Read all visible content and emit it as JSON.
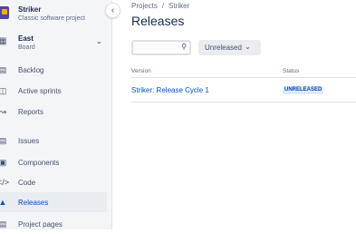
{
  "project": {
    "name": "Striker",
    "type": "Classic software project",
    "icon": "project-avatar-icon"
  },
  "board": {
    "name": "East",
    "sub": "Board",
    "icon": "board-icon"
  },
  "sidebar": {
    "items": [
      {
        "label": "Backlog",
        "icon": "backlog-icon"
      },
      {
        "label": "Active sprints",
        "icon": "active-sprints-icon"
      },
      {
        "label": "Reports",
        "icon": "reports-icon"
      },
      {
        "label": "Issues",
        "icon": "issues-icon"
      },
      {
        "label": "Components",
        "icon": "components-icon"
      },
      {
        "label": "Code",
        "icon": "code-icon"
      },
      {
        "label": "Releases",
        "icon": "releases-icon",
        "active": true
      },
      {
        "label": "Project pages",
        "icon": "project-pages-icon"
      }
    ]
  },
  "breadcrumb": {
    "items": [
      "Projects",
      "Striker"
    ],
    "separator": "/"
  },
  "page": {
    "title": "Releases"
  },
  "search": {
    "value": "",
    "placeholder": ""
  },
  "filter": {
    "label": "Unreleased"
  },
  "table": {
    "headers": {
      "version": "Version",
      "status": "Status"
    },
    "rows": [
      {
        "version": "Striker: Release Cycle 1",
        "status": "UNRELEASED"
      }
    ]
  },
  "colors": {
    "accent": "#0052cc",
    "sidebar_bg": "#f4f5f7",
    "badge_bg": "#deebff",
    "badge_text": "#0747a6",
    "project_icon": "#5243aa"
  }
}
